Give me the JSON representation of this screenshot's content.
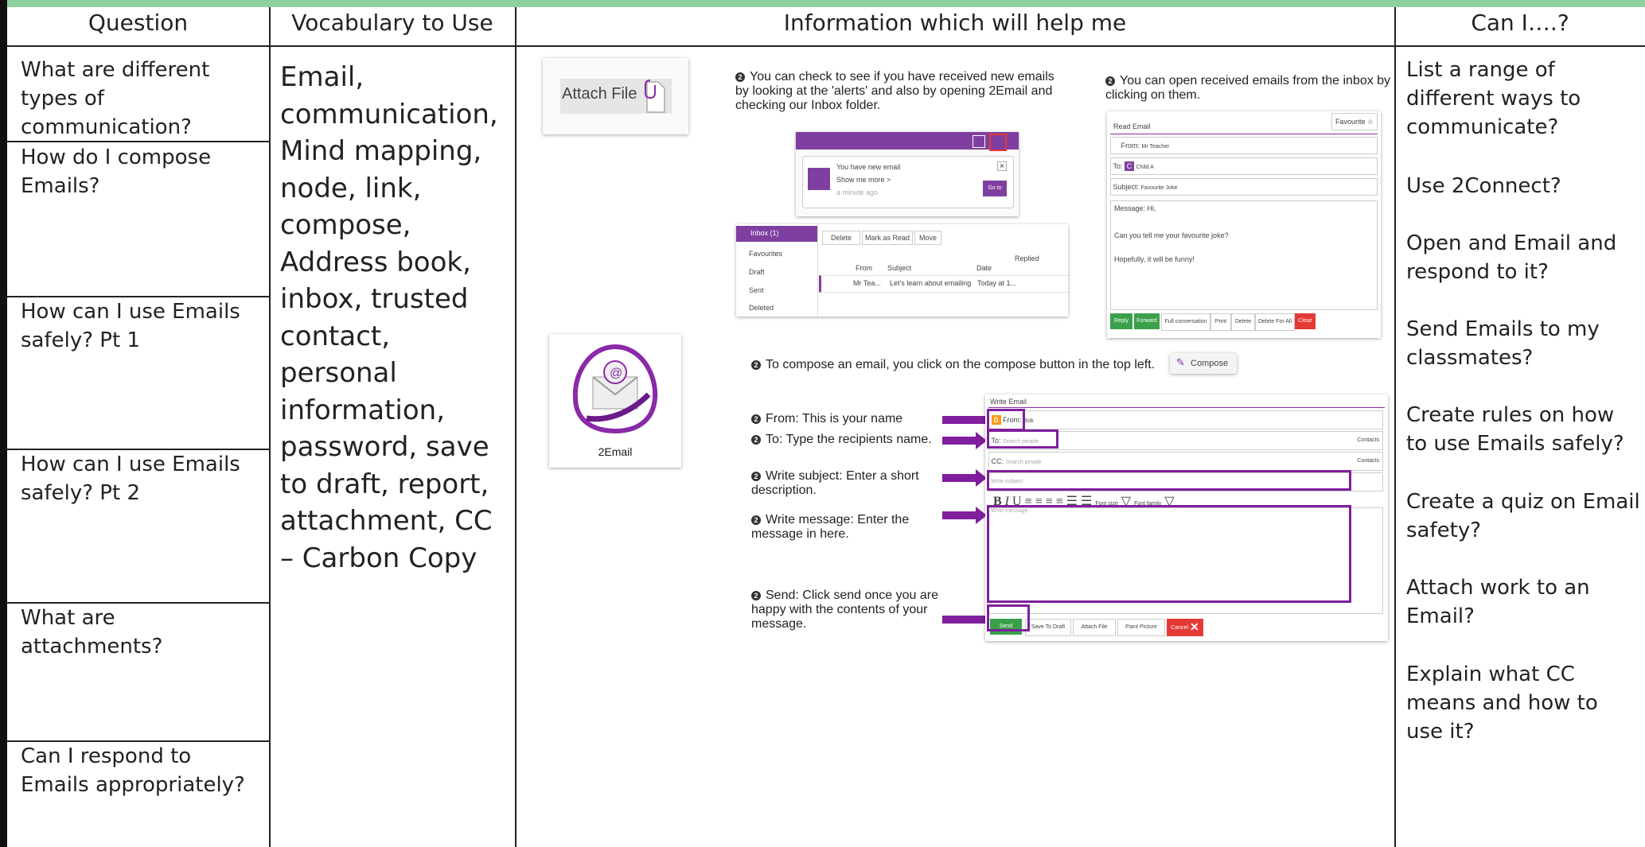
{
  "headers": {
    "question": "Question",
    "vocabulary": "Vocabulary to Use",
    "information": "Information which will help me",
    "can_i": "Can I….?"
  },
  "questions": [
    "What are different types of communication?",
    "How do I compose Emails?",
    "How can I use Emails safely? Pt 1",
    "How can I use Emails safely? Pt 2",
    "What are attachments?",
    "Can I respond to Emails appropriately?"
  ],
  "vocabulary": [
    "Email,",
    "communication,",
    "Mind mapping,",
    "node, link,",
    "compose,",
    "Address book,",
    "inbox, trusted",
    "contact, personal",
    "information,",
    "password, save",
    "to draft, report,",
    "attachment, CC",
    "– Carbon Copy"
  ],
  "can_i": [
    "List a range of different ways to communicate?",
    "Use 2Connect?",
    "Open and Email and respond to it?",
    "Send Emails to my classmates?",
    "Create rules on how to use Emails safely?",
    "Create a quiz on Email safety?",
    "Attach work to an Email?",
    "Explain what CC means and how to use it?"
  ],
  "info": {
    "attach_file_label": "Attach File",
    "app_icon_label": "2Email",
    "note_alerts": "You can check to see if you have received new emails by looking at the 'alerts' and also by opening 2Email and checking our Inbox folder.",
    "note_inbox": "You can open received emails from the inbox by clicking on them.",
    "alert": {
      "title": "You have new email",
      "show": "Show me more >",
      "time": "a minute ago",
      "go": "Go to"
    },
    "inbox": {
      "folders": [
        "Inbox (1)",
        "Favourites",
        "Draft",
        "Sent",
        "Deleted"
      ],
      "actions": [
        "Delete",
        "Mark as Read",
        "Move"
      ],
      "cols": [
        "From",
        "Subject",
        "Date",
        "Replied"
      ],
      "row": {
        "from": "Mr Tea...",
        "subject": "Let's learn about emailing",
        "date": "Today at 1..."
      }
    },
    "read_email": {
      "title": "Read Email",
      "favourite": "Favourite",
      "from_label": "From:",
      "from": "Mr Teacher",
      "to_label": "To:",
      "to": "Child A",
      "subject_label": "Subject:",
      "subject": "Favourite Joke",
      "message_label": "Message:",
      "message_1": "Hi,",
      "message_2": "Can you tell me your favourite joke?",
      "message_3": "Hopefully, it will be funny!",
      "buttons": [
        "Reply",
        "Forward",
        "Full conversation",
        "Print",
        "Delete",
        "Delete For All",
        "Close"
      ]
    },
    "note_compose": "To compose an email, you click on the compose button in the top left.",
    "compose_button": "Compose",
    "steps": [
      "From: This is your name",
      "To: Type the recipients name.",
      "Write subject: Enter a short description.",
      "Write message: Enter the message in here.",
      "Send: Click send once you are happy with the contents of your message."
    ],
    "write_email": {
      "title": "Write Email",
      "from_label": "From:",
      "from": "Bob",
      "to_label": "To:",
      "to_placeholder": "Search people",
      "cc_label": "CC:",
      "cc_placeholder": "Search people",
      "contacts": "Contacts",
      "subject_placeholder": "Write subject",
      "message_placeholder": "Write message",
      "font_size": "Font size",
      "font_family": "Font family",
      "buttons": [
        "Send",
        "Save To Draft",
        "Attach File",
        "Paint Picture",
        "Cancel"
      ]
    }
  },
  "colors": {
    "accent_purple": "#7f1f9e",
    "green_bar": "#8fd19e",
    "send_green": "#3aa04a",
    "close_red": "#e53935",
    "from_orange": "#f59c1a"
  }
}
